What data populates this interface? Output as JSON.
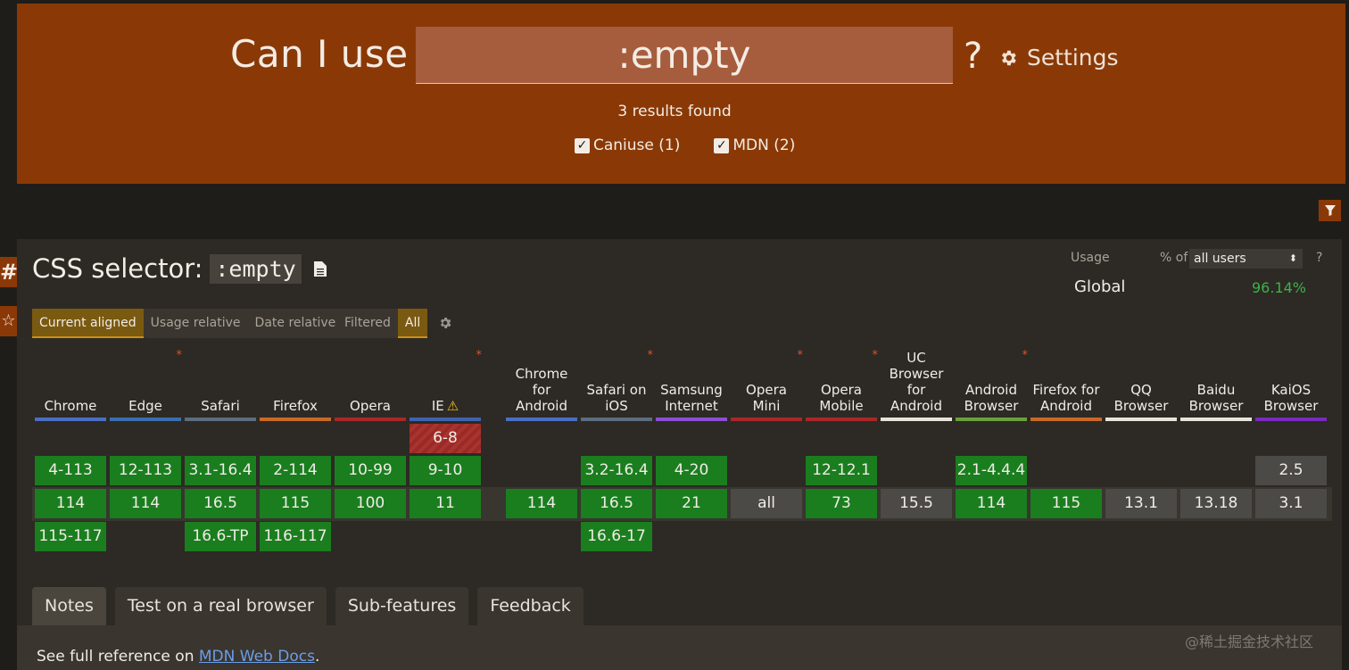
{
  "header": {
    "can_i_use": "Can I use",
    "query": ":empty",
    "qmark": "?",
    "settings_label": "Settings",
    "results": "3 results found",
    "filters": [
      {
        "label": "Caniuse (1)",
        "checked": true
      },
      {
        "label": "MDN (2)",
        "checked": true
      }
    ]
  },
  "feature": {
    "title_prefix": "CSS selector:",
    "code": ":empty",
    "side_hash": "#",
    "side_star": "☆"
  },
  "usage": {
    "label": "Usage",
    "pct_of": "% of",
    "selected": "all users",
    "help": "?",
    "global_label": "Global",
    "global_value": "96.14%"
  },
  "view_tabs": [
    "Current aligned",
    "Usage relative",
    "Date relative"
  ],
  "filter_tabs": [
    "Filtered",
    "All"
  ],
  "browsers": [
    {
      "name": "Chrome",
      "color": "#4a6fc4",
      "star": false,
      "cells": [
        "",
        "4-113",
        "114",
        "115-117"
      ]
    },
    {
      "name": "Edge",
      "color": "#3a6fb0",
      "star": true,
      "cells": [
        "",
        "12-113",
        "114",
        ""
      ]
    },
    {
      "name": "Safari",
      "color": "#5b6e7e",
      "star": false,
      "cells": [
        "",
        "3.1-16.4",
        "16.5",
        "16.6-TP"
      ]
    },
    {
      "name": "Firefox",
      "color": "#c86a26",
      "star": false,
      "cells": [
        "",
        "2-114",
        "115",
        "116-117"
      ]
    },
    {
      "name": "Opera",
      "color": "#a82828",
      "star": false,
      "cells": [
        "",
        "10-99",
        "100",
        ""
      ]
    },
    {
      "name": "IE",
      "color": "#3f63b0",
      "star": true,
      "warn": "⚠",
      "cells": [
        "6-8",
        "9-10",
        "11",
        ""
      ]
    },
    {
      "name": "Chrome for Android",
      "color": "#4a6fc4",
      "star": false,
      "cells": [
        "",
        "",
        "114",
        ""
      ]
    },
    {
      "name": "Safari on iOS",
      "color": "#5b6e7e",
      "star": true,
      "cells": [
        "",
        "3.2-16.4",
        "16.5",
        "16.6-17"
      ]
    },
    {
      "name": "Samsung Internet",
      "color": "#8b4fd6",
      "star": false,
      "cells": [
        "",
        "4-20",
        "21",
        ""
      ]
    },
    {
      "name": "Opera Mini",
      "color": "#a82828",
      "star": true,
      "cells": [
        "",
        "",
        "all",
        ""
      ]
    },
    {
      "name": "Opera Mobile",
      "color": "#a82828",
      "star": true,
      "cells": [
        "",
        "12-12.1",
        "73",
        ""
      ]
    },
    {
      "name": "UC Browser for Android",
      "color": "#e8e4dc",
      "star": false,
      "cells": [
        "",
        "",
        "15.5",
        ""
      ]
    },
    {
      "name": "Android Browser",
      "color": "#6aa23a",
      "star": true,
      "cells": [
        "",
        "2.1-4.4.4",
        "114",
        ""
      ]
    },
    {
      "name": "Firefox for Android",
      "color": "#c86a26",
      "star": false,
      "cells": [
        "",
        "",
        "115",
        ""
      ]
    },
    {
      "name": "QQ Browser",
      "color": "#e8e4dc",
      "star": false,
      "cells": [
        "",
        "",
        "13.1",
        ""
      ]
    },
    {
      "name": "Baidu Browser",
      "color": "#e8e4dc",
      "star": false,
      "cells": [
        "",
        "",
        "13.18",
        ""
      ]
    },
    {
      "name": "KaiOS Browser",
      "color": "#7a2ac0",
      "star": false,
      "cells": [
        "",
        "2.5",
        "3.1",
        ""
      ]
    }
  ],
  "bottom_tabs": [
    "Notes",
    "Test on a real browser",
    "Sub-features",
    "Feedback"
  ],
  "notes": {
    "prefix": "See full reference on ",
    "link": "MDN Web Docs",
    "suffix": "."
  },
  "watermark": "@稀土掘金技术社区"
}
